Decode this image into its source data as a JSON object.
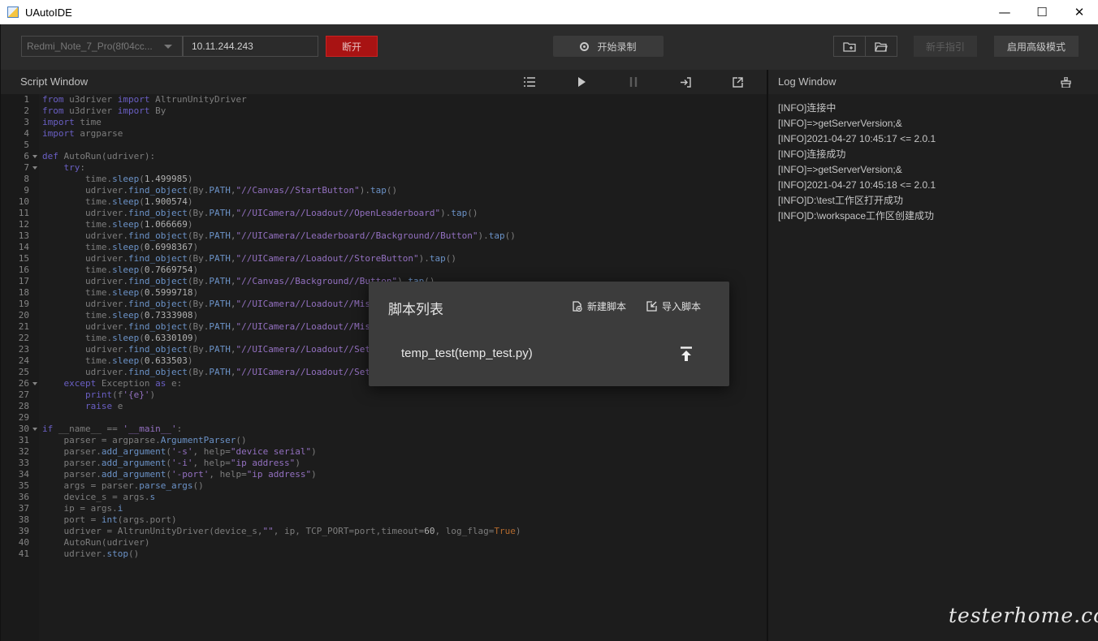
{
  "window": {
    "title": "UAutoIDE",
    "controls": [
      "—",
      "☐",
      "✕"
    ]
  },
  "toolbar": {
    "device": "Redmi_Note_7_Pro(8f04cc...",
    "ip": "10.11.244.243",
    "disconnect_label": "断开",
    "record_label": "开始录制",
    "guide_label": "新手指引",
    "advanced_label": "启用高级模式"
  },
  "script_panel": {
    "title": "Script Window"
  },
  "log_panel": {
    "title": "Log Window",
    "lines": [
      "[INFO]连接中",
      "[INFO]=>getServerVersion;&",
      "[INFO]2021-04-27 10:45:17 <= 2.0.1",
      "[INFO]连接成功",
      "[INFO]=>getServerVersion;&",
      "[INFO]2021-04-27 10:45:18 <= 2.0.1",
      "[INFO]D:\\test工作区打开成功",
      "[INFO]D:\\workspace工作区创建成功"
    ]
  },
  "editor": {
    "fold_lines": [
      6,
      7,
      26,
      30
    ],
    "lines": [
      "from u3driver import AltrunUnityDriver",
      "from u3driver import By",
      "import time",
      "import argparse",
      "",
      "def AutoRun(udriver):",
      "    try:",
      "        time.sleep(1.499985)",
      "        udriver.find_object(By.PATH,\"//Canvas//StartButton\").tap()",
      "        time.sleep(1.900574)",
      "        udriver.find_object(By.PATH,\"//UICamera//Loadout//OpenLeaderboard\").tap()",
      "        time.sleep(1.066669)",
      "        udriver.find_object(By.PATH,\"//UICamera//Leaderboard//Background//Button\").tap()",
      "        time.sleep(0.6998367)",
      "        udriver.find_object(By.PATH,\"//UICamera//Loadout//StoreButton\").tap()",
      "        time.sleep(0.7669754)",
      "        udriver.find_object(By.PATH,\"//Canvas//Background//Button\").tap()",
      "        time.sleep(0.5999718)",
      "        udriver.find_object(By.PATH,\"//UICamera//Loadout//Mis",
      "        time.sleep(0.7333908)",
      "        udriver.find_object(By.PATH,\"//UICamera//Loadout//Mis",
      "        time.sleep(0.6330109)",
      "        udriver.find_object(By.PATH,\"//UICamera//Loadout//Set",
      "        time.sleep(0.633503)",
      "        udriver.find_object(By.PATH,\"//UICamera//Loadout//Set",
      "    except Exception as e:",
      "        print(f'{e}')",
      "        raise e",
      "",
      "if __name__ == '__main__':",
      "    parser = argparse.ArgumentParser()",
      "    parser.add_argument('-s', help=\"device serial\")",
      "    parser.add_argument('-i', help=\"ip address\")",
      "    parser.add_argument('-port', help=\"ip address\")",
      "    args = parser.parse_args()",
      "    device_s = args.s",
      "    ip = args.i",
      "    port = int(args.port)",
      "    udriver = AltrunUnityDriver(device_s,\"\", ip, TCP_PORT=port,timeout=60, log_flag=True)",
      "    AutoRun(udriver)",
      "    udriver.stop()"
    ]
  },
  "modal": {
    "title": "脚本列表",
    "new_label": "新建脚本",
    "import_label": "导入脚本",
    "script_item": "temp_test(temp_test.py)"
  },
  "watermark": "testerhome.com"
}
